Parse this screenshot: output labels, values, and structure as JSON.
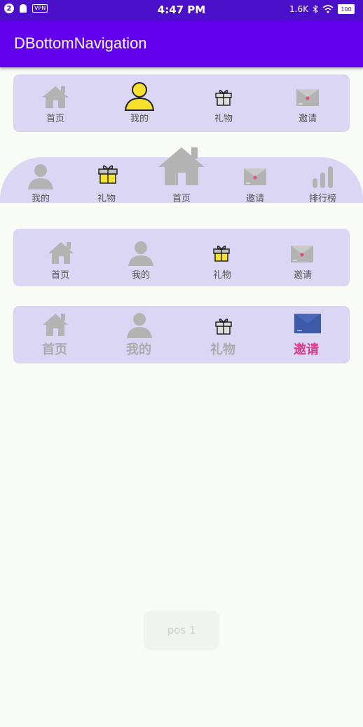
{
  "status_bar": {
    "notification_count": "2",
    "vpn": "VPN",
    "time": "4:47 PM",
    "net_speed": "1.6K",
    "battery": "100"
  },
  "app_bar": {
    "title": "DBottomNavigation"
  },
  "nav1": {
    "items": [
      "首页",
      "我的",
      "礼物",
      "邀请"
    ]
  },
  "nav2": {
    "items": [
      "我的",
      "礼物",
      "首页",
      "邀请",
      "排行榜"
    ]
  },
  "nav3": {
    "items": [
      "首页",
      "我的",
      "礼物",
      "邀请"
    ]
  },
  "nav4": {
    "items": [
      "首页",
      "我的",
      "礼物",
      "邀请"
    ],
    "active_color": "#d63f8a"
  },
  "toast": {
    "text": "pos  1"
  },
  "colors": {
    "status_bar": "#4a0fc9",
    "app_bar": "#6200ee",
    "card": "#dcd6f5",
    "icon_gray": "#b3b3b3",
    "selected_yellow": "#f7e12c"
  }
}
